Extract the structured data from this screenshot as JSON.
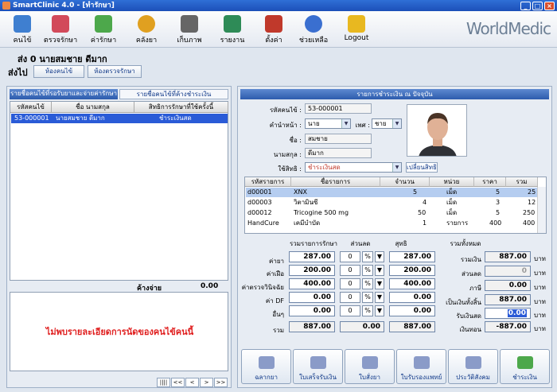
{
  "window": {
    "title": "SmartClinic 4.0 - [ทำรักษา]"
  },
  "toolbar": {
    "items": [
      {
        "label": "คนไข้",
        "icon": "patient-icon"
      },
      {
        "label": "ตรวจรักษา",
        "icon": "stethoscope-icon"
      },
      {
        "label": "ค่ารักษา",
        "icon": "money-icon"
      },
      {
        "label": "คลังยา",
        "icon": "pill-icon"
      },
      {
        "label": "เก็บภาพ",
        "icon": "camera-icon"
      },
      {
        "label": "รายงาน",
        "icon": "chart-icon"
      },
      {
        "label": "ตั้งค่า",
        "icon": "tools-icon"
      },
      {
        "label": "ช่วยเหลือ",
        "icon": "help-icon"
      },
      {
        "label": "Logout",
        "icon": "lock-icon"
      }
    ],
    "brand": "WorldMedic"
  },
  "patient_line": "ส่ง  0 นายสมชาย ดีมาก",
  "send_label": "ส่งไป",
  "send_buttons": [
    "ห้องคนไข้",
    "ห้องตรวจรักษา"
  ],
  "left": {
    "tabs": [
      "รายชื่อคนไข้ที่รอรับยาและจ่ายค่ารักษา",
      "รายชื่อคนไข้ที่ค้างชำระเงิน"
    ],
    "columns": [
      "รหัสคนไข้",
      "ชื่อ นามสกุล",
      "สิทธิการรักษาที่ใช้ครั้งนี้"
    ],
    "rows": [
      {
        "id": "53-000001",
        "name": "นายสมชาย ดีมาก",
        "right": "ชำระเงินสด"
      }
    ],
    "owed_label": "ค้างจ่าย",
    "owed_value": "0.00",
    "message": "ไม่พบรายละเอียดการนัดของคนไข้คนนี้",
    "nav": [
      "||||",
      "<<",
      "<",
      ">",
      ">>"
    ]
  },
  "right": {
    "header": "รายการชำระเงิน ณ ปัจจุบัน",
    "patient_id_label": "รหัสคนไข้ :",
    "patient_id": "53-000001",
    "prefix_label": "คำนำหน้า :",
    "prefix": "นาย",
    "gender_label": "เพศ :",
    "gender": "ชาย",
    "name_label": "ชื่อ :",
    "name": "สมชาย",
    "surname_label": "นามสกุล :",
    "surname": "ดีมาก",
    "right_label": "ใช้สิทธิ :",
    "right_value": "ชำระเงินสด",
    "change_right_btn": "เปลี่ยนสิทธิ",
    "item_columns": [
      "รหัสรายการ",
      "ชื่อรายการ",
      "จำนวน",
      "หน่วย",
      "ราคา",
      "รวม"
    ],
    "items": [
      {
        "code": "d00001",
        "name": "XNX",
        "qty": "5",
        "unit": "เม็ด",
        "price": "5",
        "total": "25"
      },
      {
        "code": "d00003",
        "name": "วิตามินซี",
        "qty": "4",
        "unit": "เม็ด",
        "price": "3",
        "total": "12"
      },
      {
        "code": "d00012",
        "name": "Tricogine 500 mg",
        "qty": "50",
        "unit": "เม็ด",
        "price": "5",
        "total": "250"
      },
      {
        "code": "HandCure",
        "name": "เคมีบำบัด",
        "qty": "1",
        "unit": "รายการ",
        "price": "400",
        "total": "400"
      }
    ],
    "sum_header": "รวมรายการรักษา",
    "discount_header": "ส่วนลด",
    "net_header": "สุทธิ",
    "grand_header": "รวมทั้งหมด",
    "cost_rows": [
      {
        "label": "ค่ายา",
        "sum": "287.00",
        "disc": "0",
        "net": "287.00"
      },
      {
        "label": "ค่าเฝือ",
        "sum": "200.00",
        "disc": "0",
        "net": "200.00"
      },
      {
        "label": "ค่าตรวจวินิจฉัย",
        "sum": "400.00",
        "disc": "0",
        "net": "400.00"
      },
      {
        "label": "ค่า DF",
        "sum": "0.00",
        "disc": "0",
        "net": "0.00"
      },
      {
        "label": "อื่นๆ",
        "sum": "0.00",
        "disc": "0",
        "net": "0.00"
      }
    ],
    "pct_symbol": "%",
    "total_label": "รวม",
    "total_sum": "887.00",
    "total_disc": "0.00",
    "total_net": "887.00",
    "grand_rows": [
      {
        "label": "รวมเงิน",
        "value": "887.00",
        "unit": "บาท"
      },
      {
        "label": "ส่วนลด",
        "value": "0",
        "unit": "บาท"
      },
      {
        "label": "ภาษี",
        "value": "0.00",
        "unit": "บาท"
      },
      {
        "label": "เป็นเงินทั้งสิ้น",
        "value": "887.00",
        "unit": "บาท"
      },
      {
        "label": "รับเงินสด",
        "value": "0.00",
        "unit": "บาท"
      },
      {
        "label": "เงินทอน",
        "value": "-887.00",
        "unit": "บาท"
      }
    ],
    "buttons": [
      "ฉลากยา",
      "ใบเสร็จรับเงิน",
      "ใบสั่งยา",
      "ใบรับรองแพทย์",
      "ประวัติสังคม",
      "ชำระเงิน"
    ]
  }
}
